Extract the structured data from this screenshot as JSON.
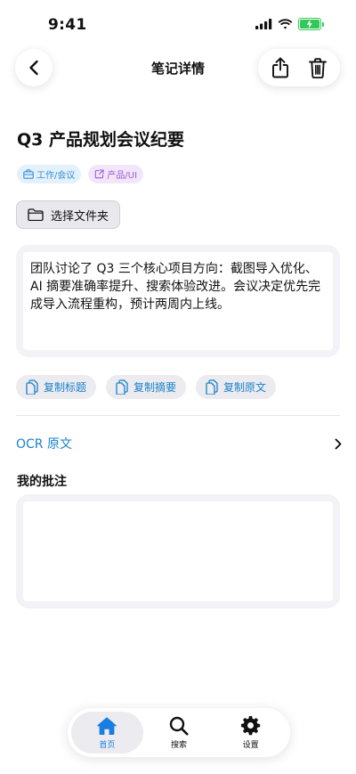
{
  "status_bar": {
    "time": "9:41"
  },
  "nav": {
    "title": "笔记详情"
  },
  "note": {
    "title": "Q3 产品规划会议纪要",
    "tags": [
      {
        "label": "工作/会议",
        "color": "#3d8fd1"
      },
      {
        "label": "产品/UI",
        "color": "#a05ad0"
      }
    ],
    "folder_button": "选择文件夹",
    "summary": "团队讨论了 Q3 三个核心项目方向：截图导入优化、AI 摘要准确率提升、搜索体验改进。会议决定优先完成导入流程重构，预计两周内上线。",
    "copy_actions": [
      "复制标题",
      "复制摘要",
      "复制原文"
    ],
    "ocr_label": "OCR 原文",
    "annotation_label": "我的批注",
    "annotation_value": ""
  },
  "tab_bar": {
    "tabs": [
      {
        "label": "首页",
        "icon": "home-icon",
        "active": true
      },
      {
        "label": "搜索",
        "icon": "search-icon",
        "active": false
      },
      {
        "label": "设置",
        "icon": "gear-icon",
        "active": false
      }
    ]
  },
  "colors": {
    "accent": "#1a82c8",
    "tab_active": "#1a7ee0",
    "battery": "#34c759"
  }
}
